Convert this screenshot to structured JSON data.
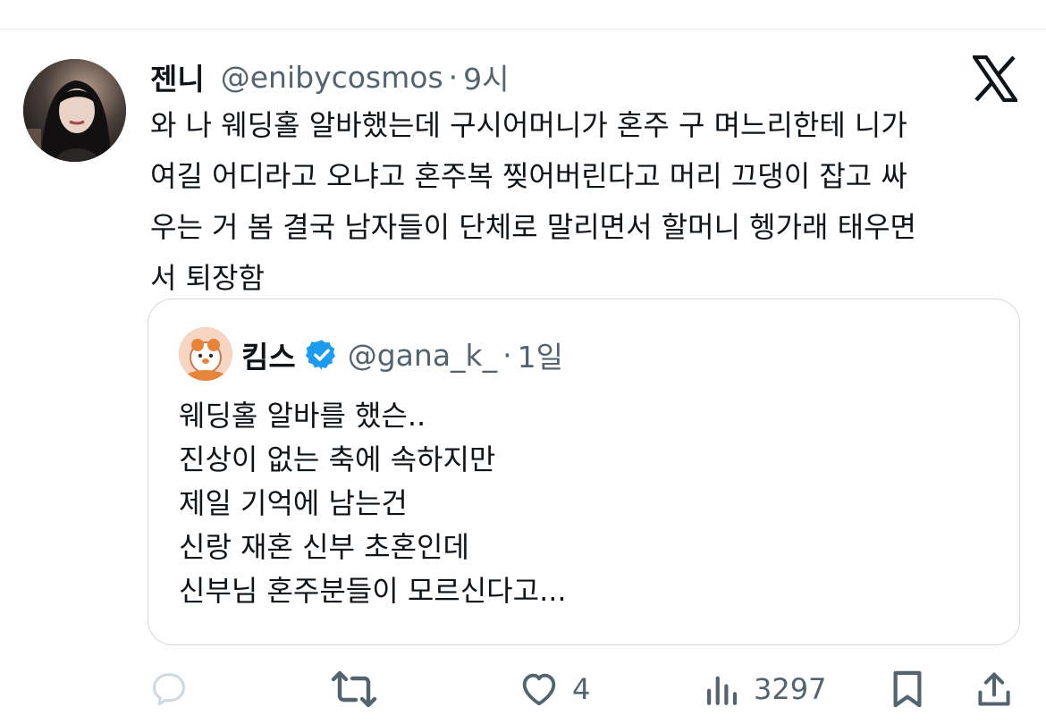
{
  "tweet": {
    "author_name": "젠니",
    "author_handle": "@enibycosmos",
    "separator": "·",
    "time": "9시",
    "text_lines": [
      "와 나 웨딩홀 알바했는데 구시어머니가 혼주 구 며느리한테 니가",
      "여길 어디라고 오냐고 혼주복 찢어버린다고 머리 끄댕이 잡고 싸",
      "우는 거 봄 결국 남자들이 단체로 말리면서 할머니 헹가래 태우면",
      "서 퇴장함"
    ]
  },
  "quote": {
    "author_name": "킴스",
    "author_handle": "@gana_k_",
    "separator": "·",
    "time": "1일",
    "text_lines": [
      "웨딩홀 알바를 했슨..",
      "진상이 없는 축에 속하지만",
      "제일 기억에 남는건",
      "신랑 재혼 신부 초혼인데",
      "신부님 혼주분들이 모르신다고..."
    ]
  },
  "actions": {
    "reply_count": "",
    "retweet_count": "",
    "like_count": "4",
    "views_count": "3297"
  },
  "icons": {
    "brand": "x-logo-icon",
    "verified": "verified-badge-icon",
    "reply": "reply-icon",
    "retweet": "retweet-icon",
    "like": "heart-icon",
    "views": "views-icon",
    "bookmark": "bookmark-icon",
    "share": "share-icon"
  },
  "colors": {
    "text_primary": "#0f1419",
    "text_secondary": "#536471",
    "verified_blue": "#1d9bf0",
    "border": "#cfd9de",
    "reply_icon_muted": "#cfd9de"
  }
}
